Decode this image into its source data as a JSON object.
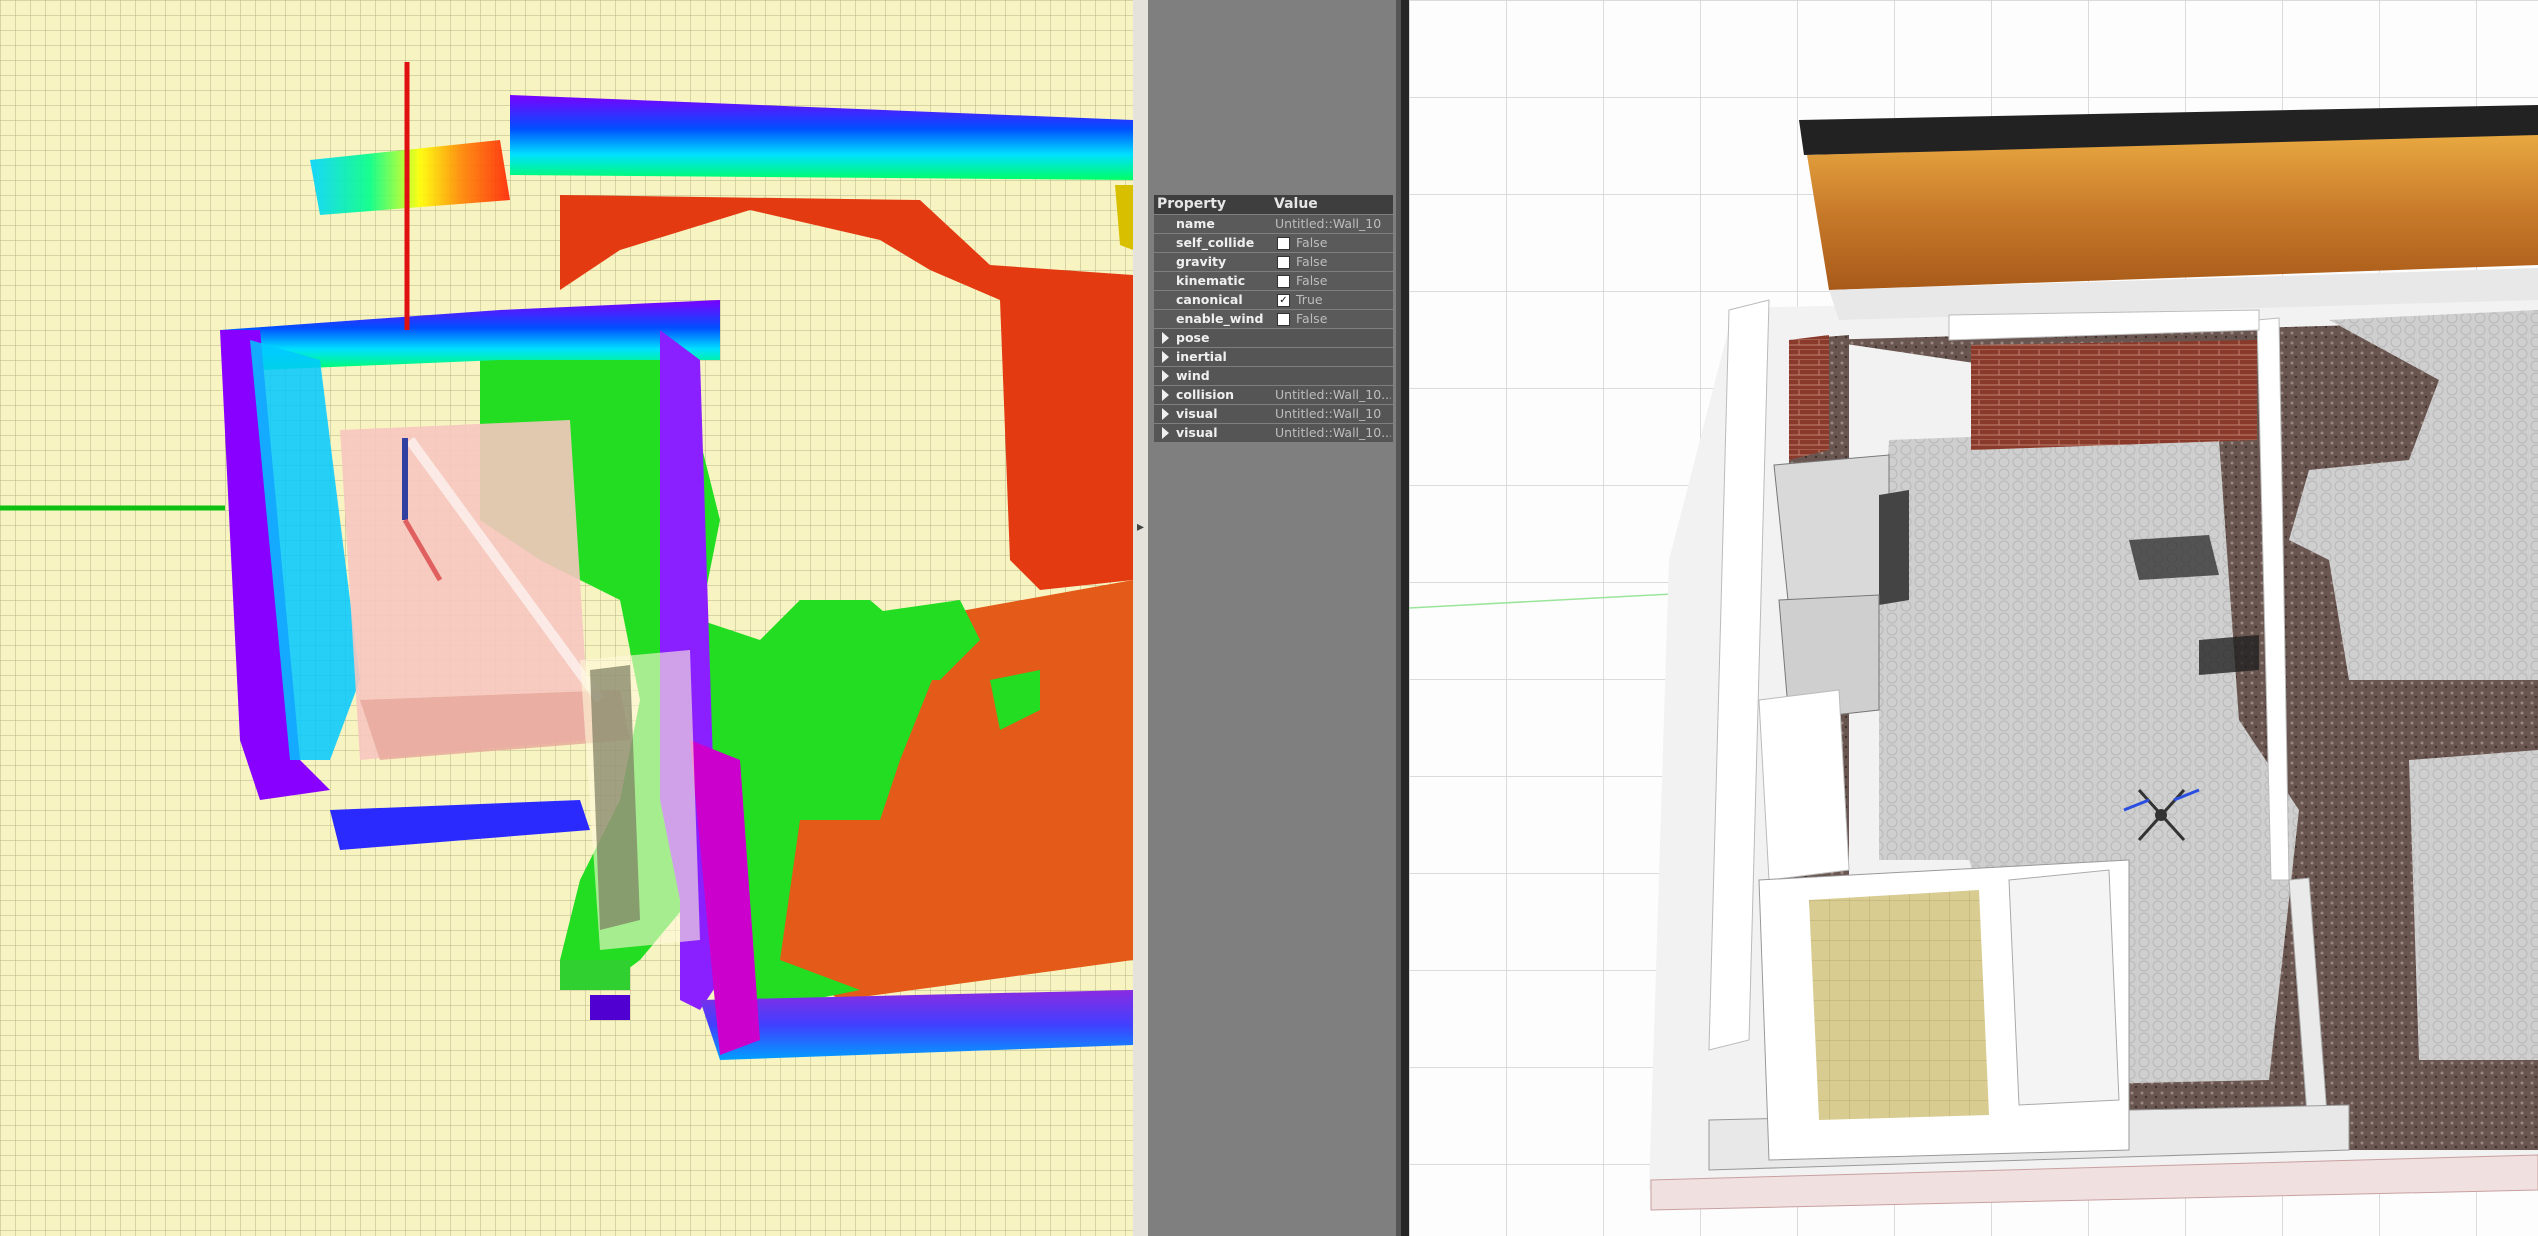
{
  "property_panel": {
    "header": {
      "property": "Property",
      "value": "Value"
    },
    "fields": [
      {
        "key": "name",
        "value": "Untitled::Wall_10"
      },
      {
        "key": "self_collide",
        "value": "False",
        "checked": false
      },
      {
        "key": "gravity",
        "value": "False",
        "checked": false
      },
      {
        "key": "kinematic",
        "value": "False",
        "checked": false
      },
      {
        "key": "canonical",
        "value": "True",
        "checked": true
      },
      {
        "key": "enable_wind",
        "value": "False",
        "checked": false
      }
    ],
    "groups": [
      {
        "key": "pose",
        "value": ""
      },
      {
        "key": "inertial",
        "value": ""
      },
      {
        "key": "wind",
        "value": ""
      },
      {
        "key": "collision",
        "value": "Untitled::Wall_10..."
      },
      {
        "key": "visual",
        "value": "Untitled::Wall_10"
      },
      {
        "key": "visual",
        "value": "Untitled::Wall_10..."
      }
    ],
    "check_mark": "✓"
  },
  "views": {
    "left": {
      "icon": "occupancy-map-3d"
    },
    "right": {
      "icon": "simulation-3d-scene"
    }
  },
  "colors": {
    "grid_background": "#f8f4c2",
    "panel_background": "#7f7f7f",
    "row_background": "#5a5a5a",
    "header_background": "#3e3e3e"
  }
}
